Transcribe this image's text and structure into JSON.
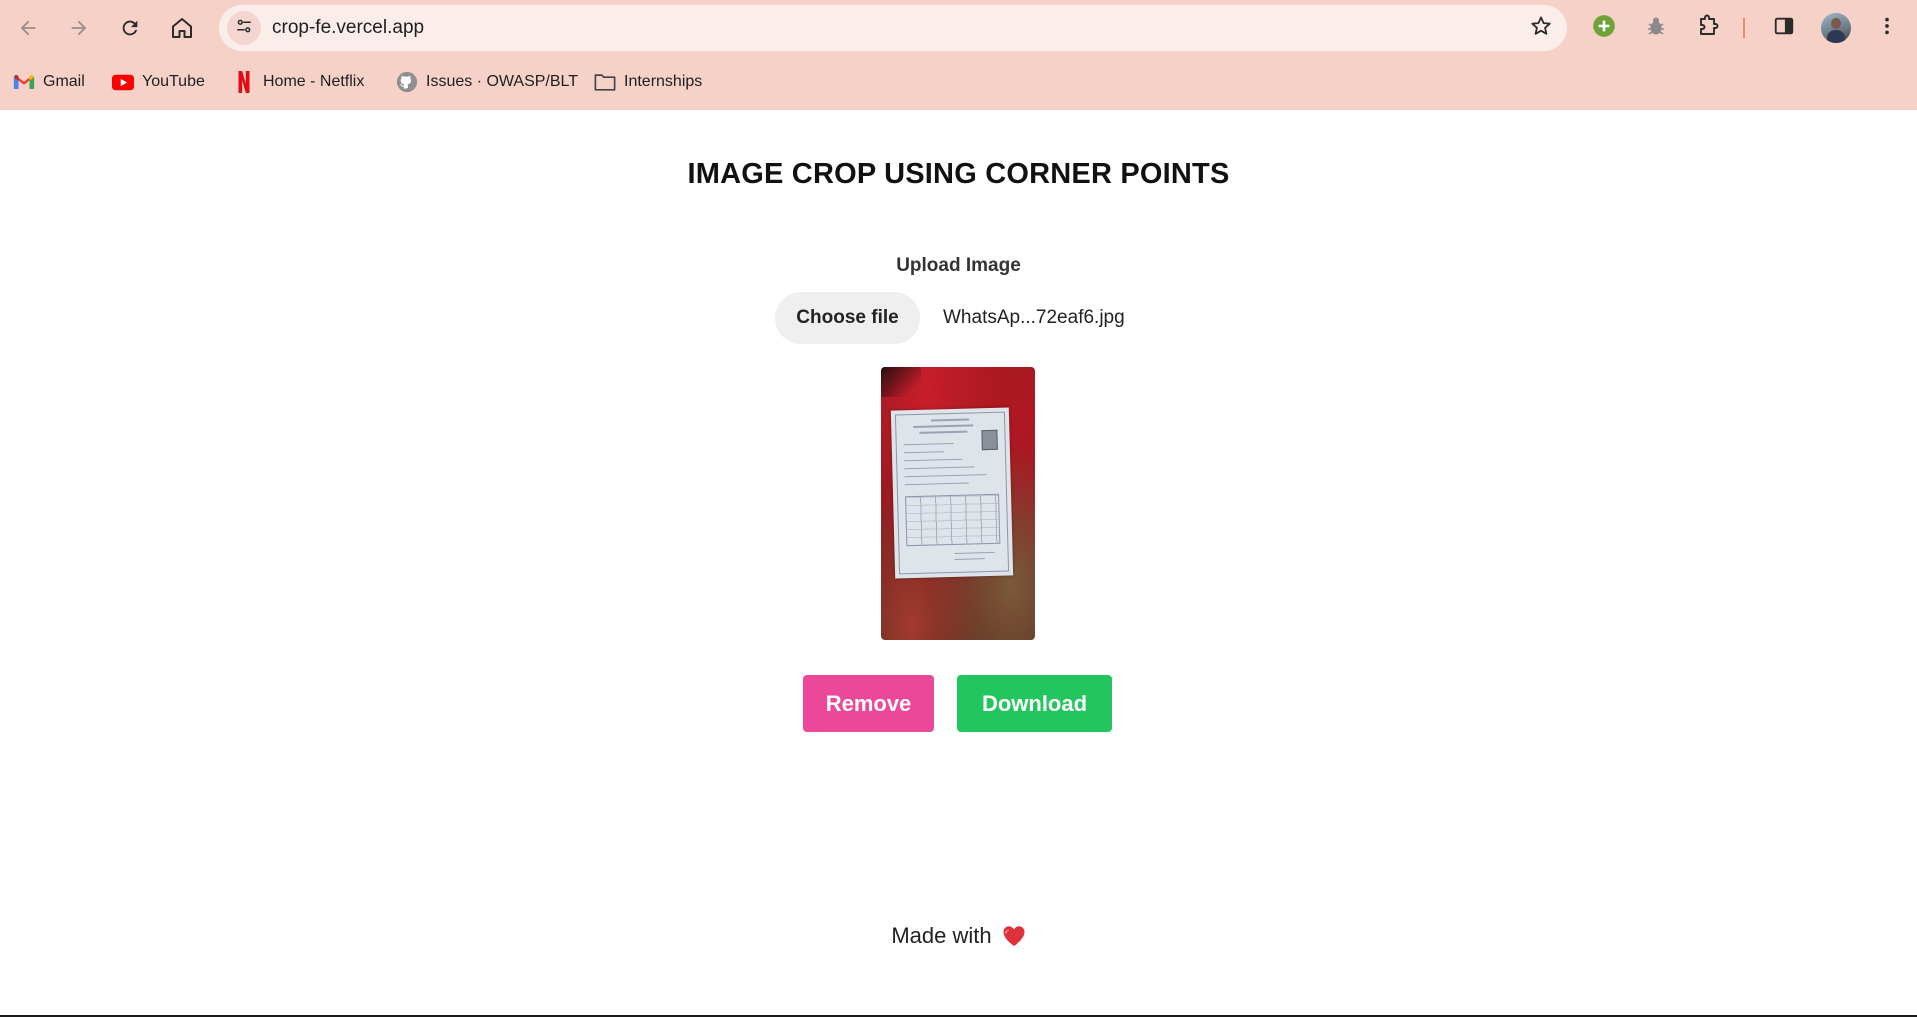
{
  "browser": {
    "url": "crop-fe.vercel.app",
    "icons": {
      "back": "arrow-left-icon",
      "forward": "arrow-right-icon",
      "reload": "reload-icon",
      "home": "home-icon",
      "site_info": "tune-icon",
      "bookmark": "star-icon",
      "extension_add": "plus-circle-icon",
      "extension_bug": "bug-icon",
      "extensions": "puzzle-icon",
      "side_panel": "side-panel-icon",
      "menu": "kebab-menu-icon"
    },
    "bookmarks": [
      {
        "label": "Gmail",
        "icon": "gmail-icon"
      },
      {
        "label": "YouTube",
        "icon": "youtube-icon"
      },
      {
        "label": "Home - Netflix",
        "icon": "netflix-icon"
      },
      {
        "label": "Issues · OWASP/BLT",
        "icon": "github-icon"
      },
      {
        "label": "Internships",
        "icon": "folder-icon"
      }
    ],
    "colors": {
      "chrome_bg": "#f6d1c8",
      "omnibox_bg": "#fbeeea"
    }
  },
  "page": {
    "title": "IMAGE CROP USING CORNER POINTS",
    "upload_label": "Upload Image",
    "choose_file_label": "Choose file",
    "file_name": "WhatsAp...72eaf6.jpg",
    "buttons": {
      "remove_label": "Remove",
      "download_label": "Download"
    },
    "footer_text": "Made with",
    "footer_icon": "heart-icon",
    "colors": {
      "remove": "#ec4899",
      "download": "#22c55e",
      "heart": "#e0303a"
    }
  }
}
